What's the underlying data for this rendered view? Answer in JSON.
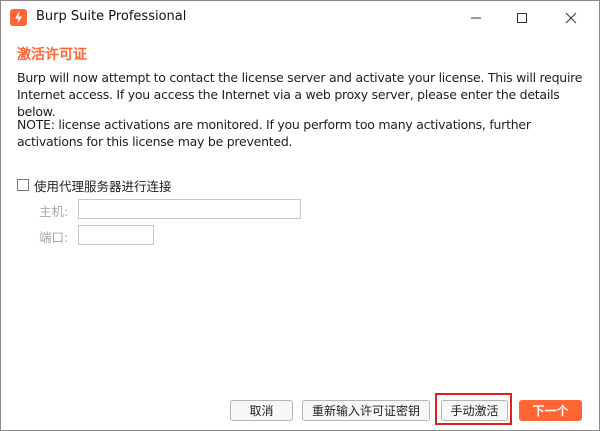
{
  "window": {
    "title": "Burp Suite Professional"
  },
  "content": {
    "heading": "激活许可证",
    "paragraph1": "Burp will now attempt to contact the license server and activate your license. This will require Internet access. If you access the Internet via a web proxy server, please enter the details below.",
    "paragraph2": "NOTE: license activations are monitored. If you perform too many activations, further activations for this license may be prevented.",
    "proxy": {
      "checkbox_label": "使用代理服务器进行连接",
      "checked": false,
      "host_label": "主机:",
      "host_value": "",
      "port_label": "端口:",
      "port_value": ""
    }
  },
  "buttons": {
    "cancel": "取消",
    "reenter": "重新输入许可证密钥",
    "manual": "手动激活",
    "next": "下一个"
  },
  "colors": {
    "accent": "#ff6633",
    "highlight": "#e02020"
  }
}
